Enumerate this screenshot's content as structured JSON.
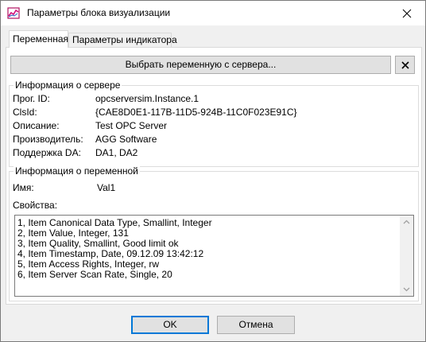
{
  "window": {
    "title": "Параметры блока визуализации",
    "icon": "chart-app-icon"
  },
  "tabs": [
    {
      "label": "Переменная",
      "active": true
    },
    {
      "label": "Параметры индикатора",
      "active": false
    }
  ],
  "toolbar": {
    "select_label": "Выбрать переменную с сервера...",
    "clear_label": "✕"
  },
  "server_info": {
    "title": "Информация о сервере",
    "rows": [
      {
        "label": "Прог. ID:",
        "value": "opcserversim.Instance.1"
      },
      {
        "label": "ClsId:",
        "value": "{CAE8D0E1-117B-11D5-924B-11C0F023E91C}"
      },
      {
        "label": "Описание:",
        "value": "Test OPC Server"
      },
      {
        "label": "Производитель:",
        "value": "AGG Software"
      },
      {
        "label": "Поддержка DA:",
        "value": "DA1, DA2"
      }
    ]
  },
  "variable_info": {
    "title": "Информация о переменной",
    "name_label": "Имя:",
    "name_value": "Val1",
    "props_label": "Свойства:",
    "properties": [
      "1, Item Canonical Data Type, Smallint, Integer",
      "2, Item Value, Integer, 131",
      "3, Item Quality, Smallint, Good limit ok",
      "4, Item Timestamp, Date, 09.12.09 13:42:12",
      "5, Item Access Rights, Integer, rw",
      "6, Item Server Scan Rate, Single, 20"
    ]
  },
  "buttons": {
    "ok": "OK",
    "cancel": "Отмена"
  },
  "colors": {
    "accent": "#0078d7",
    "window_bg": "#f0f0f0",
    "panel_bg": "#ffffff"
  }
}
